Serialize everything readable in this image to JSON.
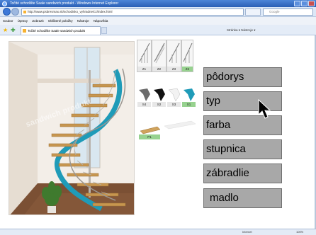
{
  "window": {
    "title": "Točité schodište Saale sandwich produkt - Windows Internet Explorer"
  },
  "address_bar": {
    "url": "http://www.psbresmax.sk/schodisko_vyhradne/cz/index.html",
    "search_placeholder": "Google"
  },
  "menubar": {
    "items": [
      "Soubor",
      "Úpravy",
      "Zobrazit",
      "Oblíbené položky",
      "Nástroje",
      "Nápověda"
    ]
  },
  "tabs": [
    {
      "label": "Točité schodište Saale sandwich produkt"
    }
  ],
  "toolbar": {
    "tools_text": "Stránka ▾  Nástroje ▾"
  },
  "scene": {
    "watermark": "sandwich produkt"
  },
  "railing_options": [
    {
      "label": "Z1"
    },
    {
      "label": "Z2"
    },
    {
      "label": "Z3"
    },
    {
      "label": "Z4",
      "selected": true
    }
  ],
  "color_options": [
    {
      "label": "S4"
    },
    {
      "label": "S2"
    },
    {
      "label": "S3"
    },
    {
      "label": "S1",
      "selected": true
    }
  ],
  "tread_options": [
    {
      "label": "P1",
      "selected": true
    }
  ],
  "menu": {
    "items": [
      "pôdorys",
      "typ",
      "farba",
      "stupnica",
      "zábradlie",
      "madlo"
    ]
  },
  "statusbar": {
    "zone": "Internet",
    "zoom": "100%"
  },
  "colors": {
    "menu_button_bg": "#a8a8a8",
    "selected_option": "#97d28f",
    "stair_accent": "#1f9bb8",
    "titlebar": "#2a5fb5"
  }
}
